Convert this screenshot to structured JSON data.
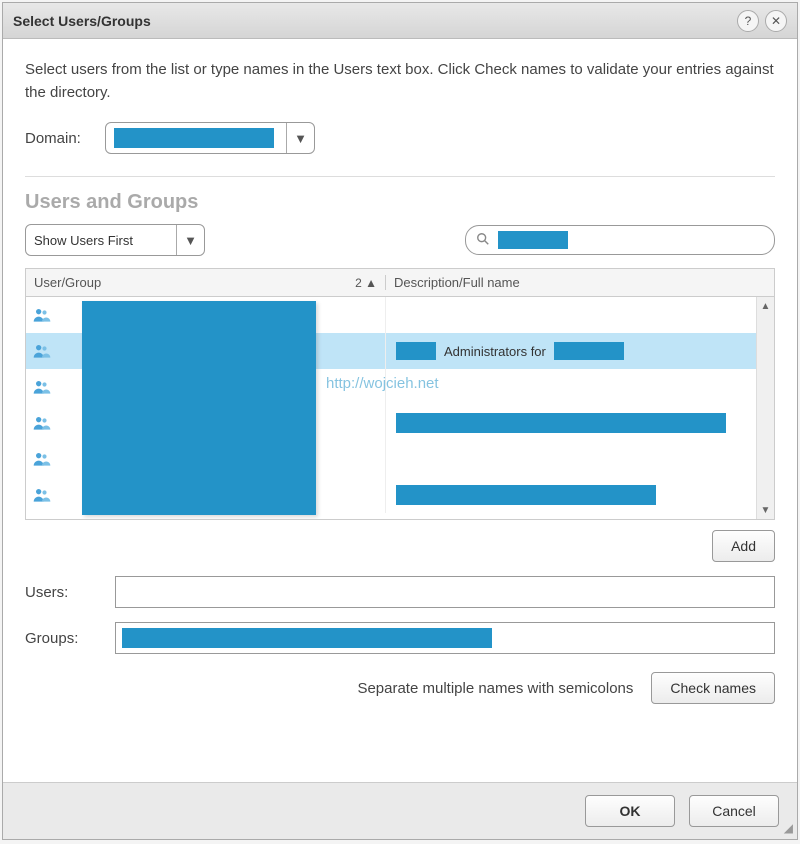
{
  "dialog": {
    "title": "Select Users/Groups",
    "instructions": "Select users from the list or type names in the Users text box. Click Check names to validate your entries against the directory.",
    "domain_label": "Domain:",
    "sort_label": "Show Users First",
    "section_title": "Users and Groups",
    "columns": {
      "usergroup": "User/Group",
      "sort_indicator": "2 ▲",
      "description": "Description/Full name"
    },
    "rows": [
      {
        "desc_text": "",
        "selected": false
      },
      {
        "desc_text": "Administrators for",
        "selected": true
      },
      {
        "desc_text": "",
        "selected": false
      },
      {
        "desc_text": "",
        "selected": false
      },
      {
        "desc_text": "",
        "selected": false
      },
      {
        "desc_text": "",
        "selected": false
      }
    ],
    "watermark": "http://wojcieh.net",
    "add_label": "Add",
    "users_label": "Users:",
    "groups_label": "Groups:",
    "hint": "Separate multiple names with semicolons",
    "check_label": "Check names",
    "ok_label": "OK",
    "cancel_label": "Cancel"
  }
}
